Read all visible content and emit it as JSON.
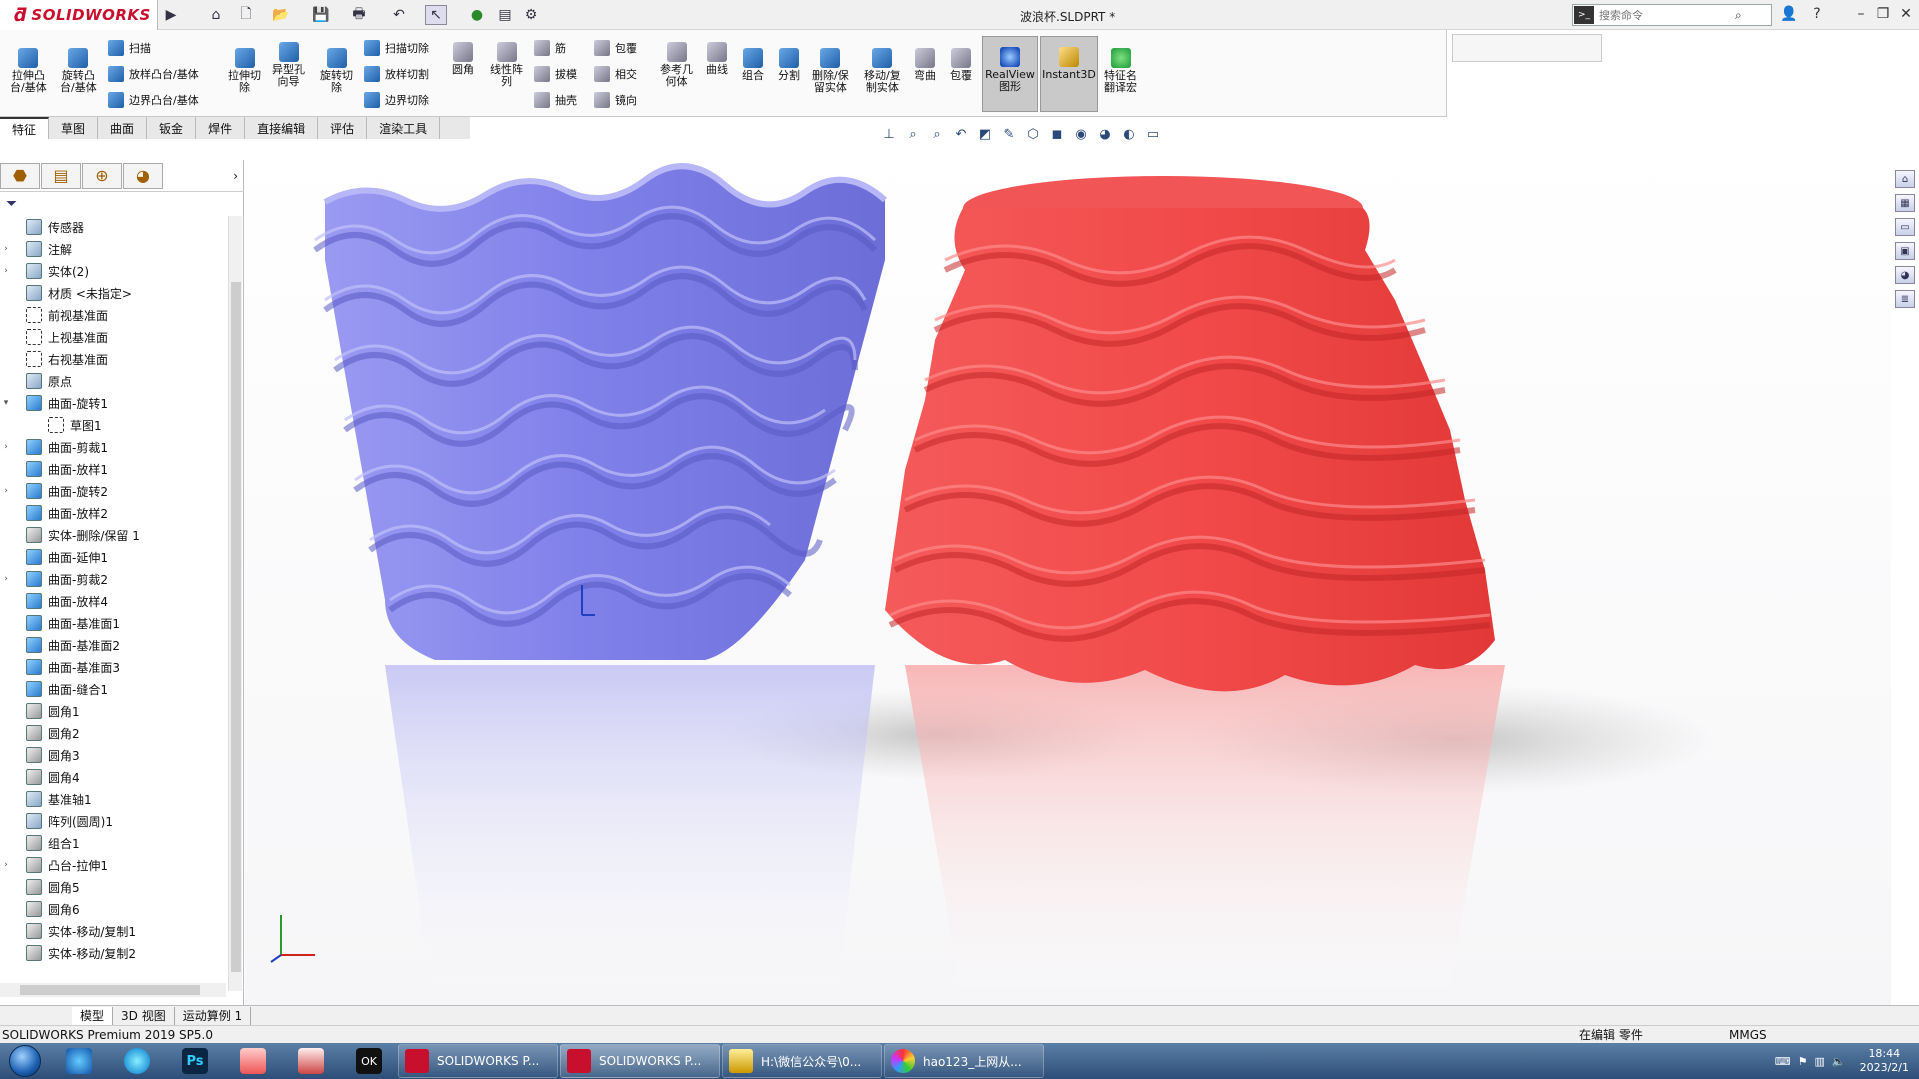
{
  "app": {
    "brand": "SOLIDWORKS",
    "document_title": "波浪杯.SLDPRT *",
    "search_placeholder": "搜索命令"
  },
  "command_manager": {
    "tools": [
      {
        "label": "拉伸凸\n台/基体",
        "icon": "extruded-boss-icon"
      },
      {
        "label": "旋转凸\n台/基体",
        "icon": "revolved-boss-icon"
      },
      {
        "label": "扫描",
        "icon": "swept-boss-icon"
      },
      {
        "label": "放样凸台/基体",
        "icon": "lofted-boss-icon"
      },
      {
        "label": "边界凸台/基体",
        "icon": "boundary-boss-icon"
      },
      {
        "label": "拉伸切\n除",
        "icon": "extruded-cut-icon"
      },
      {
        "label": "异型孔\n向导",
        "icon": "hole-wizard-icon"
      },
      {
        "label": "旋转切\n除",
        "icon": "revolved-cut-icon"
      },
      {
        "label": "扫描切除",
        "icon": "swept-cut-icon"
      },
      {
        "label": "放样切割",
        "icon": "lofted-cut-icon"
      },
      {
        "label": "边界切除",
        "icon": "boundary-cut-icon"
      },
      {
        "label": "圆角",
        "icon": "fillet-icon"
      },
      {
        "label": "线性阵\n列",
        "icon": "linear-pattern-icon"
      },
      {
        "label": "筋",
        "icon": "rib-icon"
      },
      {
        "label": "拔模",
        "icon": "draft-icon"
      },
      {
        "label": "抽壳",
        "icon": "shell-icon"
      },
      {
        "label": "包覆",
        "icon": "wrap-icon"
      },
      {
        "label": "相交",
        "icon": "intersect-icon"
      },
      {
        "label": "镜向",
        "icon": "mirror-icon"
      },
      {
        "label": "参考几\n何体",
        "icon": "reference-geometry-icon"
      },
      {
        "label": "曲线",
        "icon": "curves-icon"
      },
      {
        "label": "组合",
        "icon": "combine-icon"
      },
      {
        "label": "分割",
        "icon": "split-icon"
      },
      {
        "label": "删除/保\n留实体",
        "icon": "delete-keep-body-icon"
      },
      {
        "label": "移动/复\n制实体",
        "icon": "move-copy-body-icon"
      },
      {
        "label": "弯曲",
        "icon": "flex-icon"
      },
      {
        "label": "包覆",
        "icon": "wrap-icon-2"
      },
      {
        "label": "RealView\n图形",
        "icon": "realview-icon"
      },
      {
        "label": "Instant3D",
        "icon": "instant3d-icon"
      },
      {
        "label": "特征名\n翻译宏",
        "icon": "feature-name-macro-icon"
      }
    ],
    "tabs": [
      "特征",
      "草图",
      "曲面",
      "钣金",
      "焊件",
      "直接编辑",
      "评估",
      "渲染工具"
    ],
    "active_tab": "特征"
  },
  "feature_tree": [
    {
      "label": "传感器",
      "icon": "sensor-icon",
      "expandable": false
    },
    {
      "label": "注解",
      "icon": "annotation-icon",
      "expandable": true
    },
    {
      "label": "实体(2)",
      "icon": "solid-bodies-icon",
      "expandable": true
    },
    {
      "label": "材质 <未指定>",
      "icon": "material-icon",
      "expandable": false
    },
    {
      "label": "前视基准面",
      "icon": "plane-icon",
      "expandable": false
    },
    {
      "label": "上视基准面",
      "icon": "plane-icon",
      "expandable": false
    },
    {
      "label": "右视基准面",
      "icon": "plane-icon",
      "expandable": false
    },
    {
      "label": "原点",
      "icon": "origin-icon",
      "expandable": false
    },
    {
      "label": "曲面-旋转1",
      "icon": "surface-revolve-icon",
      "expandable": true,
      "expanded": true
    },
    {
      "label": "草图1",
      "icon": "sketch-icon",
      "expandable": false,
      "indent": 1
    },
    {
      "label": "曲面-剪裁1",
      "icon": "surface-trim-icon",
      "expandable": true
    },
    {
      "label": "曲面-放样1",
      "icon": "surface-loft-icon",
      "expandable": false
    },
    {
      "label": "曲面-旋转2",
      "icon": "surface-revolve-icon",
      "expandable": true
    },
    {
      "label": "曲面-放样2",
      "icon": "surface-loft-icon",
      "expandable": false
    },
    {
      "label": "实体-删除/保留 1",
      "icon": "delete-body-icon",
      "expandable": false
    },
    {
      "label": "曲面-延伸1",
      "icon": "surface-extend-icon",
      "expandable": false
    },
    {
      "label": "曲面-剪裁2",
      "icon": "surface-trim-icon",
      "expandable": true
    },
    {
      "label": "曲面-放样4",
      "icon": "surface-loft-icon",
      "expandable": false
    },
    {
      "label": "曲面-基准面1",
      "icon": "planar-surface-icon",
      "expandable": false
    },
    {
      "label": "曲面-基准面2",
      "icon": "planar-surface-icon",
      "expandable": false
    },
    {
      "label": "曲面-基准面3",
      "icon": "planar-surface-icon",
      "expandable": false
    },
    {
      "label": "曲面-缝合1",
      "icon": "surface-knit-icon",
      "expandable": false
    },
    {
      "label": "圆角1",
      "icon": "fillet-icon",
      "expandable": false
    },
    {
      "label": "圆角2",
      "icon": "fillet-icon",
      "expandable": false
    },
    {
      "label": "圆角3",
      "icon": "fillet-icon",
      "expandable": false
    },
    {
      "label": "圆角4",
      "icon": "fillet-icon",
      "expandable": false
    },
    {
      "label": "基准轴1",
      "icon": "axis-icon",
      "expandable": false
    },
    {
      "label": "阵列(圆周)1",
      "icon": "circular-pattern-icon",
      "expandable": false
    },
    {
      "label": "组合1",
      "icon": "combine-icon",
      "expandable": false
    },
    {
      "label": "凸台-拉伸1",
      "icon": "boss-extrude-icon",
      "expandable": true
    },
    {
      "label": "圆角5",
      "icon": "fillet-icon",
      "expandable": false
    },
    {
      "label": "圆角6",
      "icon": "fillet-icon",
      "expandable": false
    },
    {
      "label": "实体-移动/复制1",
      "icon": "move-copy-icon",
      "expandable": false
    },
    {
      "label": "实体-移动/复制2",
      "icon": "move-copy-icon",
      "expandable": false
    }
  ],
  "model_tabs": [
    "模型",
    "3D 视图",
    "运动算例 1"
  ],
  "status": {
    "product": "SOLIDWORKS Premium 2019 SP5.0",
    "mode": "在编辑 零件",
    "units": "MMGS"
  },
  "taskbar": {
    "tasks": [
      "SOLIDWORKS P...",
      "SOLIDWORKS P...",
      "H:\\微信公众号\\0...",
      "hao123_上网从..."
    ],
    "time": "18:44",
    "date": "2023/2/1"
  },
  "colors": {
    "blue_cup": "#7f7fe8",
    "red_cup": "#f04545",
    "brand_red": "#c8102e"
  }
}
